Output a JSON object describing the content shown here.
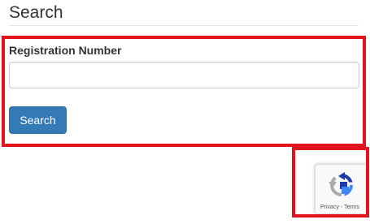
{
  "page": {
    "title": "Search"
  },
  "form": {
    "field_label": "Registration Number",
    "field_value": "",
    "field_placeholder": "",
    "search_label": "Search"
  },
  "recaptcha": {
    "logo_icon": "recaptcha-logo-icon",
    "privacy_label": "Privacy",
    "separator": " - ",
    "terms_label": "Terms"
  },
  "colors": {
    "highlight": "#e3131e",
    "button": "#337ab7",
    "recaptcha_blue": "#1c3aa9",
    "recaptcha_light_blue": "#4285f4",
    "recaptcha_gray": "#ababab"
  }
}
